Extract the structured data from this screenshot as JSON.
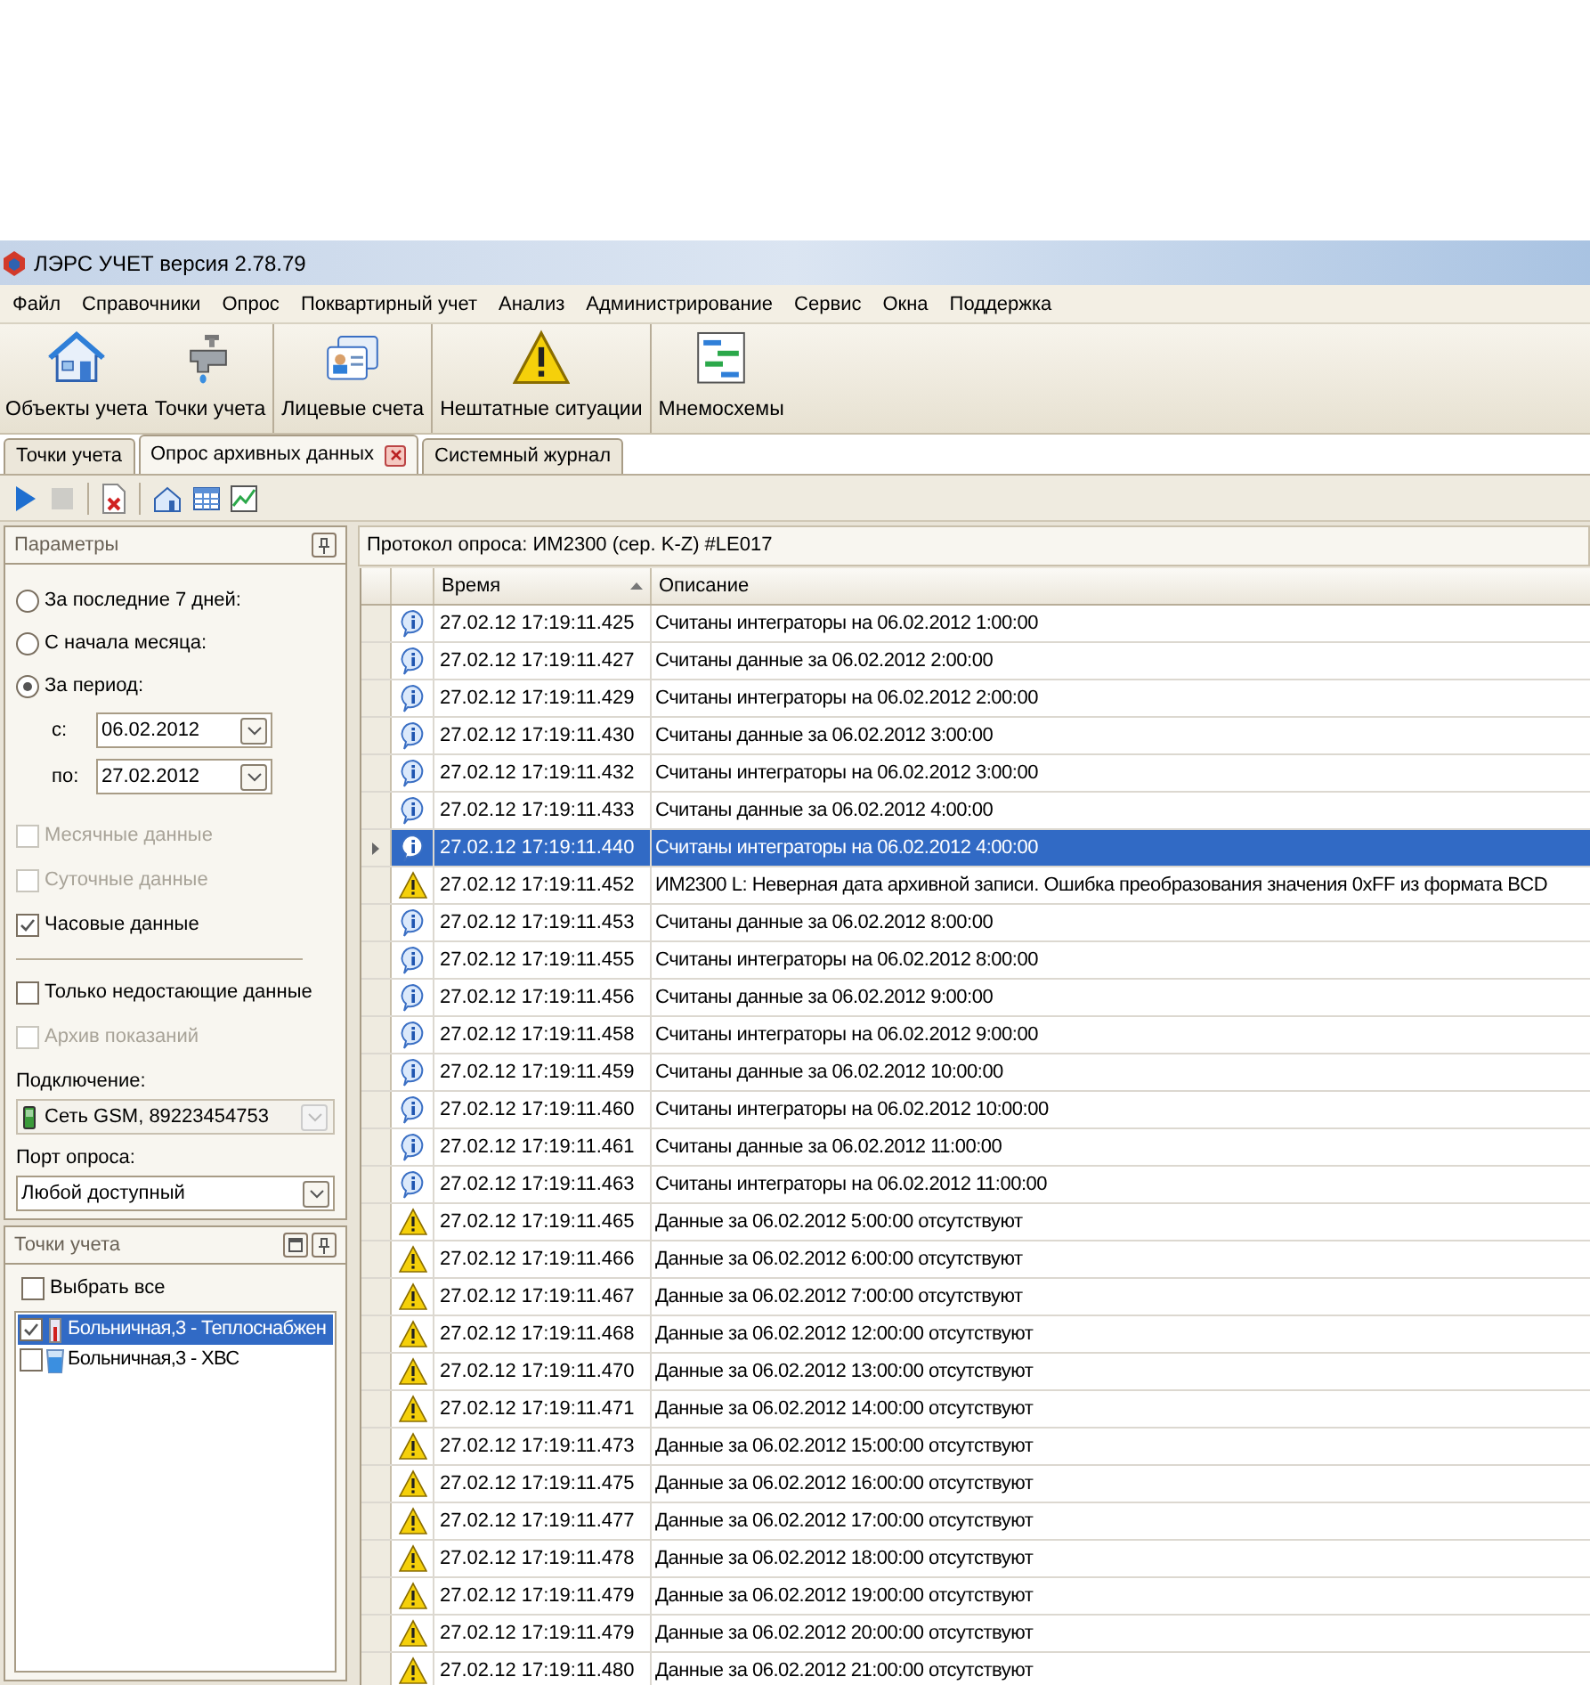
{
  "window": {
    "title": "ЛЭРС УЧЕТ версия 2.78.79"
  },
  "menu": [
    "Файл",
    "Справочники",
    "Опрос",
    "Поквартирный учет",
    "Анализ",
    "Администрирование",
    "Сервис",
    "Окна",
    "Поддержка"
  ],
  "toolbar": [
    {
      "label": "Объекты учета",
      "kind": "house",
      "separator_before": false
    },
    {
      "label": "Точки учета",
      "kind": "tap",
      "separator_before": false
    },
    {
      "label": "Лицевые счета",
      "kind": "cards",
      "separator_before": true
    },
    {
      "label": "Нештатные ситуации",
      "kind": "warning",
      "separator_before": true
    },
    {
      "label": "Мнемосхемы",
      "kind": "diagram",
      "separator_before": true
    }
  ],
  "tabs": [
    {
      "label": "Точки учета",
      "selected": false,
      "closable": false
    },
    {
      "label": "Опрос архивных данных",
      "selected": true,
      "closable": true
    },
    {
      "label": "Системный журнал",
      "selected": false,
      "closable": false
    }
  ],
  "subtoolbar": [
    {
      "kind": "play",
      "disabled": false
    },
    {
      "kind": "stop",
      "disabled": true
    },
    {
      "kind": "sep"
    },
    {
      "kind": "delete",
      "disabled": false
    },
    {
      "kind": "sep"
    },
    {
      "kind": "house",
      "disabled": false
    },
    {
      "kind": "table",
      "disabled": false
    },
    {
      "kind": "chart",
      "disabled": false
    }
  ],
  "parameters": {
    "title": "Параметры",
    "radios": [
      {
        "label": "За последние 7 дней:",
        "selected": false
      },
      {
        "label": "С начала месяца:",
        "selected": false
      },
      {
        "label": "За период:",
        "selected": true
      }
    ],
    "dates": [
      {
        "label": "с:",
        "value": "06.02.2012"
      },
      {
        "label": "по:",
        "value": "27.02.2012"
      }
    ],
    "checks_a": [
      {
        "label": "Месячные данные",
        "checked": false,
        "disabled": true
      },
      {
        "label": "Суточные данные",
        "checked": false,
        "disabled": true
      },
      {
        "label": "Часовые данные",
        "checked": true,
        "disabled": false
      }
    ],
    "checks_b": [
      {
        "label": "Только недостающие данные",
        "checked": false,
        "disabled": false
      },
      {
        "label": "Архив показаний",
        "checked": false,
        "disabled": true
      }
    ],
    "connection": {
      "label": "Подключение:",
      "value": "Сеть GSM, 89223454753",
      "disabled": true
    },
    "port": {
      "label": "Порт опроса:",
      "value": "Любой доступный"
    }
  },
  "points": {
    "title": "Точки учета",
    "select_all": {
      "label": "Выбрать все",
      "checked": false
    },
    "items": [
      {
        "label": "Больничная,3 - Теплоснабжен",
        "checked": true,
        "selected": true,
        "kind": "heat"
      },
      {
        "label": "Больничная,3 - ХВС",
        "checked": false,
        "selected": false,
        "kind": "water"
      }
    ]
  },
  "log": {
    "title": "Протокол опроса: ИМ2300 (сер. K-Z) #LE017",
    "columns": [
      "Время",
      "Описание"
    ],
    "rows": [
      {
        "kind": "info",
        "selected": false,
        "time": "27.02.12 17:19:11.425",
        "text": "Считаны интеграторы на 06.02.2012 1:00:00"
      },
      {
        "kind": "info",
        "selected": false,
        "time": "27.02.12 17:19:11.427",
        "text": "Считаны данные за 06.02.2012 2:00:00"
      },
      {
        "kind": "info",
        "selected": false,
        "time": "27.02.12 17:19:11.429",
        "text": "Считаны интеграторы на 06.02.2012 2:00:00"
      },
      {
        "kind": "info",
        "selected": false,
        "time": "27.02.12 17:19:11.430",
        "text": "Считаны данные за 06.02.2012 3:00:00"
      },
      {
        "kind": "info",
        "selected": false,
        "time": "27.02.12 17:19:11.432",
        "text": "Считаны интеграторы на 06.02.2012 3:00:00"
      },
      {
        "kind": "info",
        "selected": false,
        "time": "27.02.12 17:19:11.433",
        "text": "Считаны данные за 06.02.2012 4:00:00"
      },
      {
        "kind": "info",
        "selected": true,
        "time": "27.02.12 17:19:11.440",
        "text": "Считаны интеграторы на 06.02.2012 4:00:00"
      },
      {
        "kind": "warning",
        "selected": false,
        "time": "27.02.12 17:19:11.452",
        "text": "ИМ2300 L: Неверная дата архивной записи. Ошибка преобразования значения 0xFF из формата BCD"
      },
      {
        "kind": "info",
        "selected": false,
        "time": "27.02.12 17:19:11.453",
        "text": "Считаны данные за 06.02.2012 8:00:00"
      },
      {
        "kind": "info",
        "selected": false,
        "time": "27.02.12 17:19:11.455",
        "text": "Считаны интеграторы на 06.02.2012 8:00:00"
      },
      {
        "kind": "info",
        "selected": false,
        "time": "27.02.12 17:19:11.456",
        "text": "Считаны данные за 06.02.2012 9:00:00"
      },
      {
        "kind": "info",
        "selected": false,
        "time": "27.02.12 17:19:11.458",
        "text": "Считаны интеграторы на 06.02.2012 9:00:00"
      },
      {
        "kind": "info",
        "selected": false,
        "time": "27.02.12 17:19:11.459",
        "text": "Считаны данные за 06.02.2012 10:00:00"
      },
      {
        "kind": "info",
        "selected": false,
        "time": "27.02.12 17:19:11.460",
        "text": "Считаны интеграторы на 06.02.2012 10:00:00"
      },
      {
        "kind": "info",
        "selected": false,
        "time": "27.02.12 17:19:11.461",
        "text": "Считаны данные за 06.02.2012 11:00:00"
      },
      {
        "kind": "info",
        "selected": false,
        "time": "27.02.12 17:19:11.463",
        "text": "Считаны интеграторы на 06.02.2012 11:00:00"
      },
      {
        "kind": "warning",
        "selected": false,
        "time": "27.02.12 17:19:11.465",
        "text": "Данные за 06.02.2012 5:00:00 отсутствуют"
      },
      {
        "kind": "warning",
        "selected": false,
        "time": "27.02.12 17:19:11.466",
        "text": "Данные за 06.02.2012 6:00:00 отсутствуют"
      },
      {
        "kind": "warning",
        "selected": false,
        "time": "27.02.12 17:19:11.467",
        "text": "Данные за 06.02.2012 7:00:00 отсутствуют"
      },
      {
        "kind": "warning",
        "selected": false,
        "time": "27.02.12 17:19:11.468",
        "text": "Данные за 06.02.2012 12:00:00 отсутствуют"
      },
      {
        "kind": "warning",
        "selected": false,
        "time": "27.02.12 17:19:11.470",
        "text": "Данные за 06.02.2012 13:00:00 отсутствуют"
      },
      {
        "kind": "warning",
        "selected": false,
        "time": "27.02.12 17:19:11.471",
        "text": "Данные за 06.02.2012 14:00:00 отсутствуют"
      },
      {
        "kind": "warning",
        "selected": false,
        "time": "27.02.12 17:19:11.473",
        "text": "Данные за 06.02.2012 15:00:00 отсутствуют"
      },
      {
        "kind": "warning",
        "selected": false,
        "time": "27.02.12 17:19:11.475",
        "text": "Данные за 06.02.2012 16:00:00 отсутствуют"
      },
      {
        "kind": "warning",
        "selected": false,
        "time": "27.02.12 17:19:11.477",
        "text": "Данные за 06.02.2012 17:00:00 отсутствуют"
      },
      {
        "kind": "warning",
        "selected": false,
        "time": "27.02.12 17:19:11.478",
        "text": "Данные за 06.02.2012 18:00:00 отсутствуют"
      },
      {
        "kind": "warning",
        "selected": false,
        "time": "27.02.12 17:19:11.479",
        "text": "Данные за 06.02.2012 19:00:00 отсутствуют"
      },
      {
        "kind": "warning",
        "selected": false,
        "time": "27.02.12 17:19:11.479",
        "text": "Данные за 06.02.2012 20:00:00 отсутствуют"
      },
      {
        "kind": "warning",
        "selected": false,
        "time": "27.02.12 17:19:11.480",
        "text": "Данные за 06.02.2012 21:00:00 отсутствуют"
      }
    ]
  }
}
